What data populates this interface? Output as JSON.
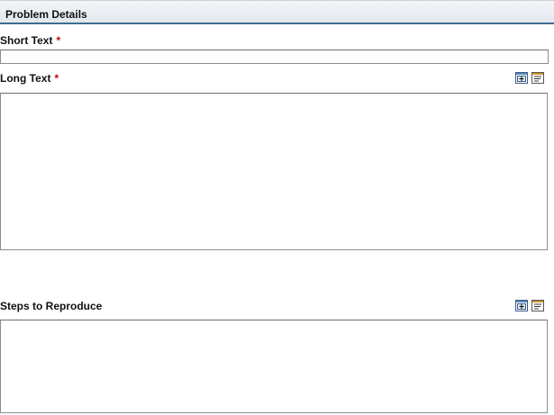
{
  "section": {
    "title": "Problem Details"
  },
  "fields": {
    "short_text": {
      "label": "Short Text",
      "required_marker": "*",
      "value": ""
    },
    "long_text": {
      "label": "Long Text",
      "required_marker": "*",
      "value": ""
    },
    "steps": {
      "label": "Steps to Reproduce",
      "value": ""
    }
  },
  "icons": {
    "expand": "expand-editor-icon",
    "spellcheck": "spell-check-icon"
  }
}
